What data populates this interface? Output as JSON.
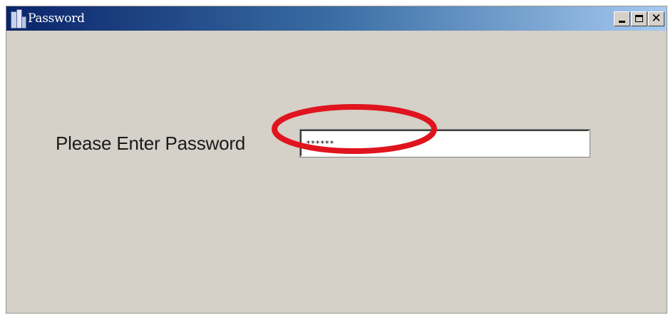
{
  "window": {
    "title": "Password",
    "title_color": "#ffffff",
    "titlebar_gradient": [
      "#0a246a",
      "#a6caf0"
    ],
    "background": "#d5d0c8",
    "controls": {
      "minimize_icon": "minimize-icon",
      "maximize_icon": "maximize-icon",
      "close_icon": "close-icon",
      "close_glyph": "✕"
    }
  },
  "form": {
    "prompt_label": "Please Enter Password",
    "password_value": "******"
  },
  "annotation": {
    "color": "#e0141e",
    "shape": "ellipse"
  }
}
